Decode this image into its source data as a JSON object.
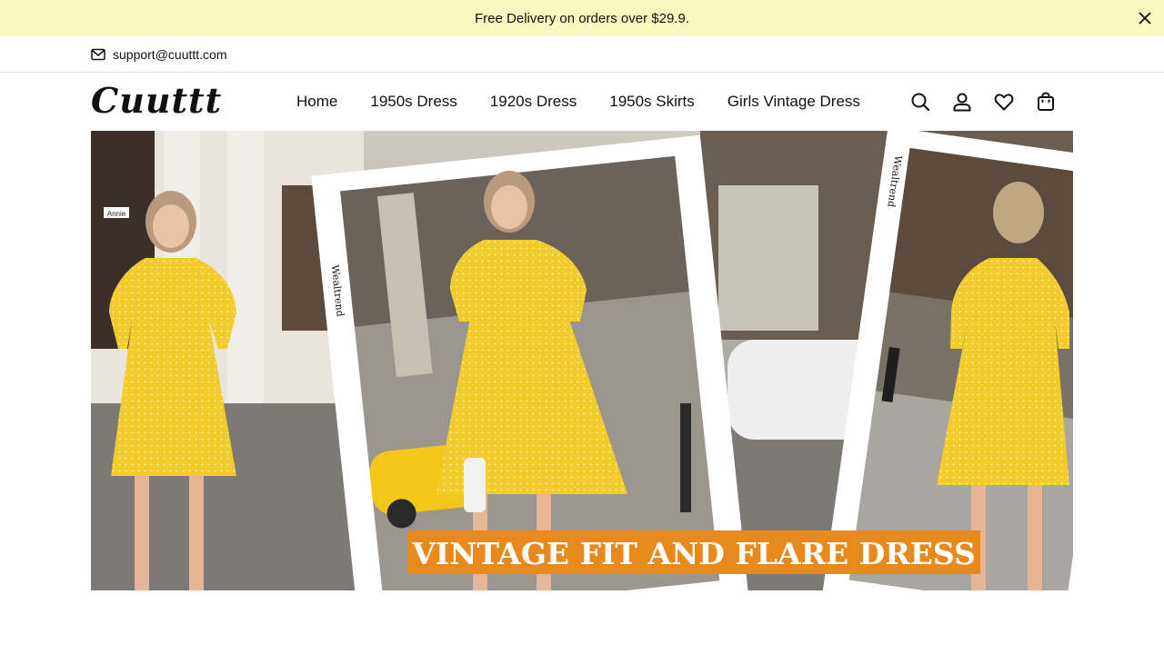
{
  "announcement": {
    "text": "Free Delivery on orders over $29.9."
  },
  "topbar": {
    "email": "support@cuuttt.com"
  },
  "header": {
    "logo": "Cuuttt",
    "nav": [
      {
        "label": "Home"
      },
      {
        "label": "1950s Dress"
      },
      {
        "label": "1920s Dress"
      },
      {
        "label": "1950s Skirts"
      },
      {
        "label": "Girls Vintage Dress"
      }
    ],
    "icons": [
      "search-icon",
      "account-icon",
      "wishlist-icon",
      "cart-icon"
    ]
  },
  "hero": {
    "banner_text": "VINTAGE FIT AND FLARE DRESS",
    "watermark": "Wealtrend",
    "street_sign": "Annie"
  },
  "colors": {
    "announcement_bg": "#f8f8c0",
    "dress_yellow": "#f2cc2c",
    "banner_orange": "#e8891e",
    "taxi_yellow": "#f3c618"
  }
}
